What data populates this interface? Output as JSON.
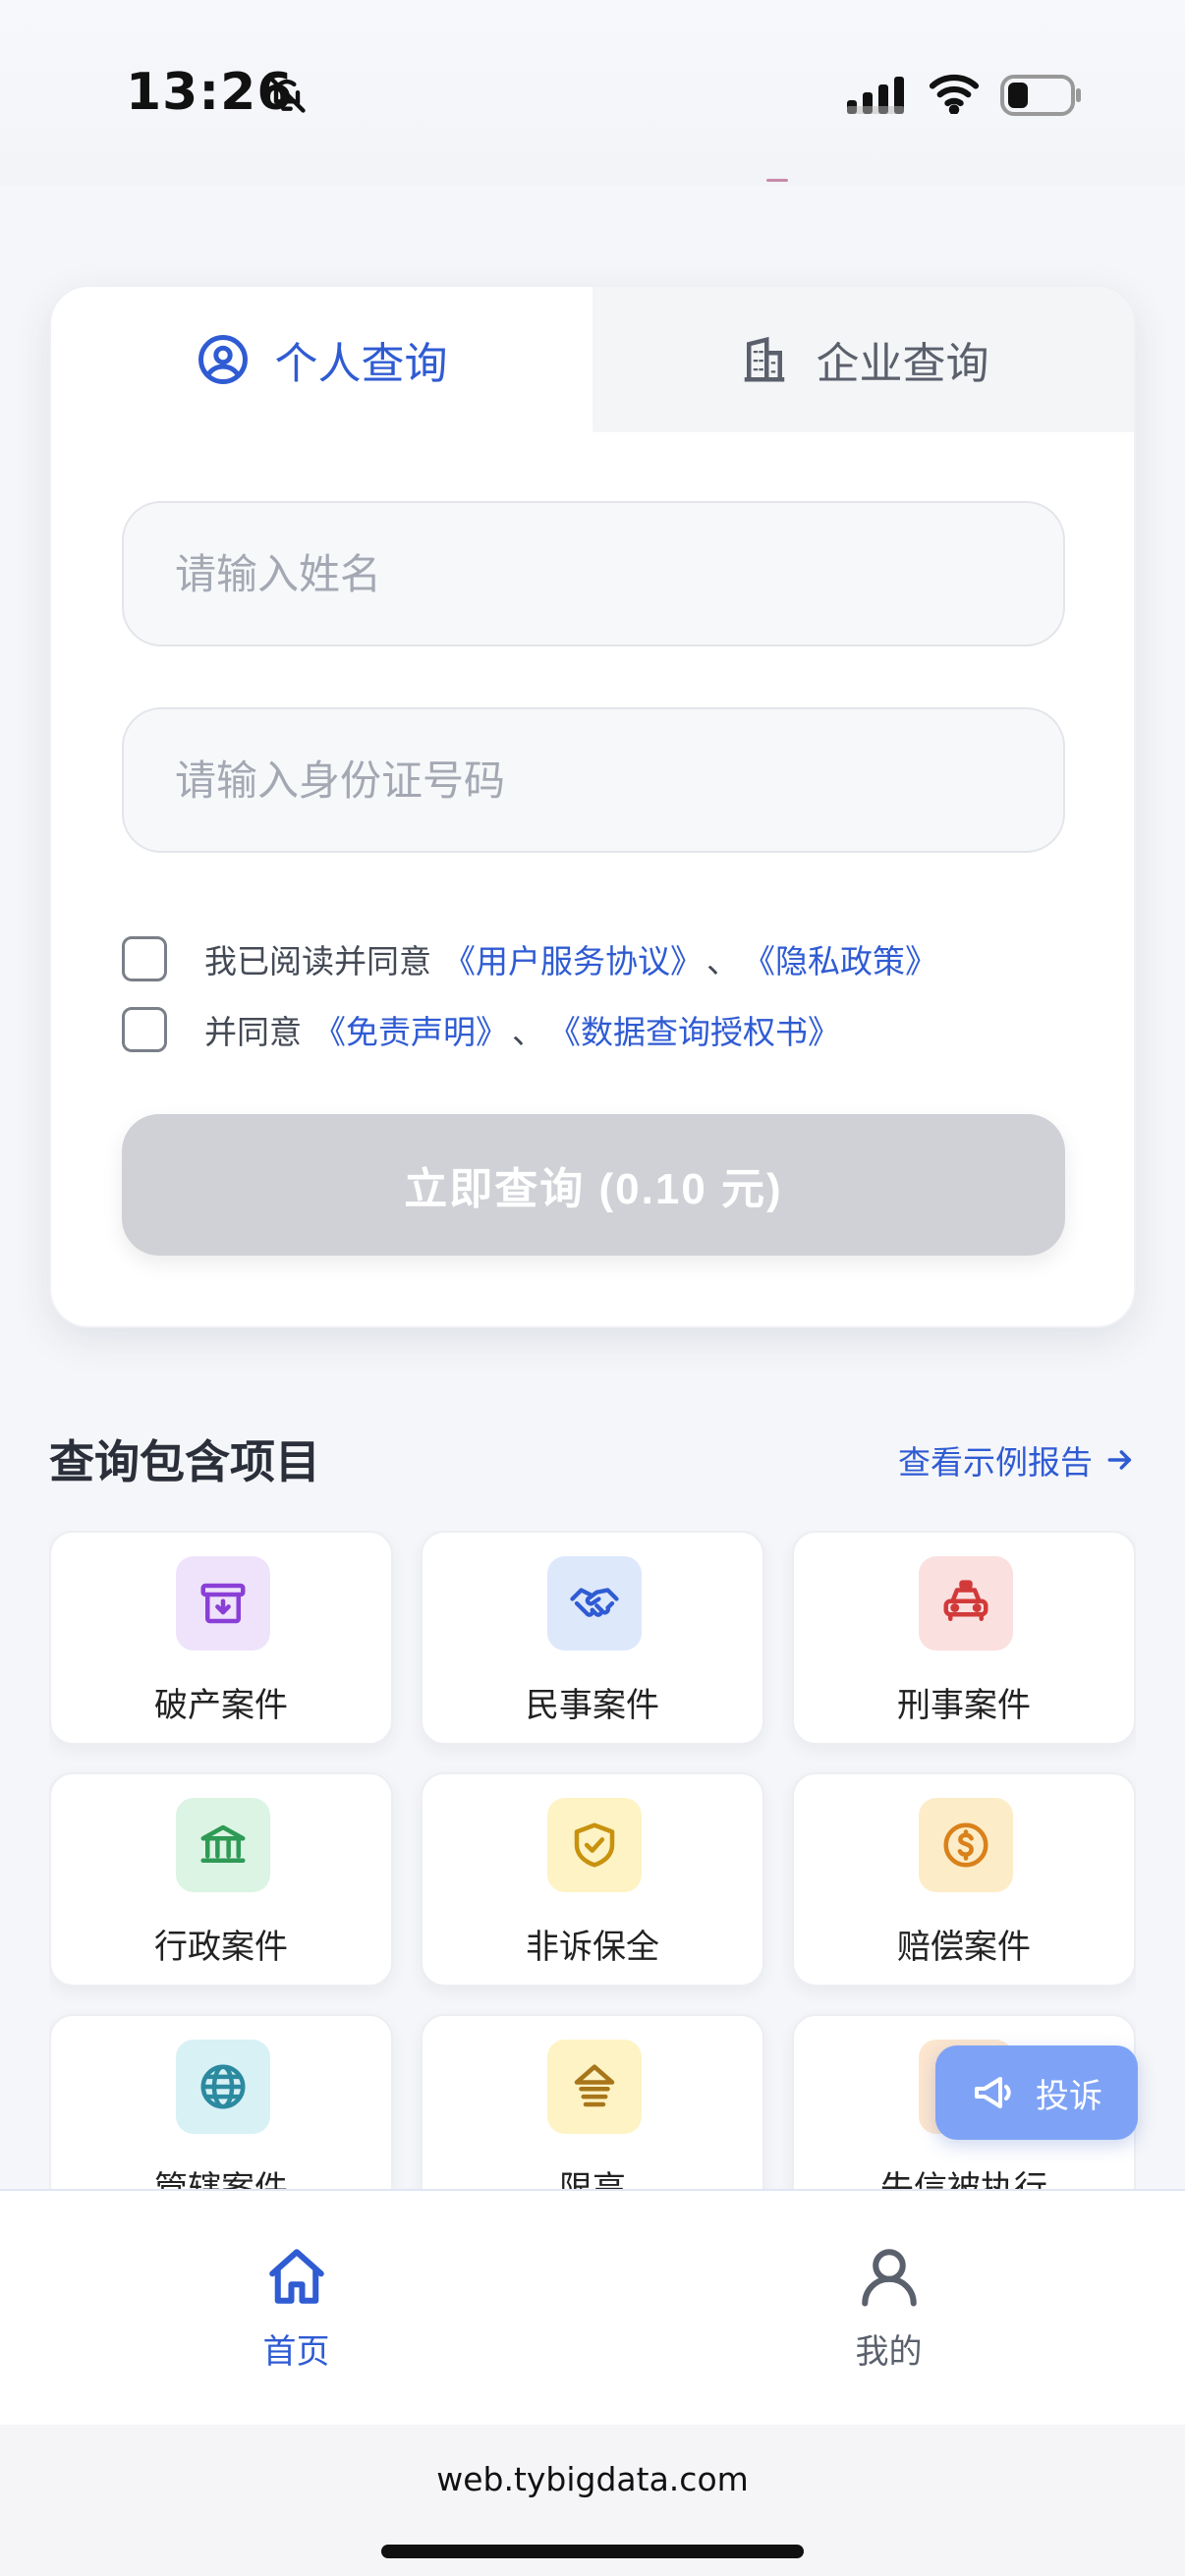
{
  "status_bar": {
    "time": "13:26"
  },
  "tabs": [
    {
      "label": "个人查询",
      "icon": "user-circle-icon",
      "active": true
    },
    {
      "label": "企业查询",
      "icon": "building-icon",
      "active": false
    }
  ],
  "form": {
    "name_placeholder": "请输入姓名",
    "id_placeholder": "请输入身份证号码",
    "agree1_prefix": "我已阅读并同意",
    "agree1_link1": "《用户服务协议》",
    "agree1_sep": "、",
    "agree1_link2": "《隐私政策》",
    "agree2_prefix": "并同意",
    "agree2_link1": "《免责声明》",
    "agree2_sep": "、",
    "agree2_link2": "《数据查询授权书》",
    "submit_label": "立即查询 (0.10 元)"
  },
  "section": {
    "title": "查询包含项目",
    "sample_link": "查看示例报告"
  },
  "items": [
    {
      "label": "破产案件",
      "icon": "archive-download-icon",
      "bg": "#efe3fb",
      "color": "#8a3fd6"
    },
    {
      "label": "民事案件",
      "icon": "handshake-icon",
      "bg": "#dde8fb",
      "color": "#2f5bd3"
    },
    {
      "label": "刑事案件",
      "icon": "police-car-icon",
      "bg": "#fbe0e0",
      "color": "#d23a3a"
    },
    {
      "label": "行政案件",
      "icon": "bank-icon",
      "bg": "#dcf4e3",
      "color": "#2f9a55"
    },
    {
      "label": "非诉保全",
      "icon": "shield-check-icon",
      "bg": "#fdf3c4",
      "color": "#c8920e"
    },
    {
      "label": "赔偿案件",
      "icon": "dollar-circle-icon",
      "bg": "#fdecc8",
      "color": "#d9811a"
    },
    {
      "label": "管辖案件",
      "icon": "globe-icon",
      "bg": "#d8f1f5",
      "color": "#2c8aa0"
    },
    {
      "label": "限高",
      "icon": "limit-up-icon",
      "bg": "#fdf3c4",
      "color": "#a8761a"
    },
    {
      "label": "失信被执行",
      "icon": "warning-icon",
      "bg": "#fde6cf",
      "color": "#d9811a"
    }
  ],
  "complaint": {
    "label": "投诉"
  },
  "bottom_nav": [
    {
      "label": "首页",
      "icon": "home-icon",
      "active": true
    },
    {
      "label": "我的",
      "icon": "user-icon",
      "active": false
    }
  ],
  "browser": {
    "url": "web.tybigdata.com"
  },
  "colors": {
    "accent": "#2f5bd3",
    "disabled_button": "#cfd1d6"
  }
}
